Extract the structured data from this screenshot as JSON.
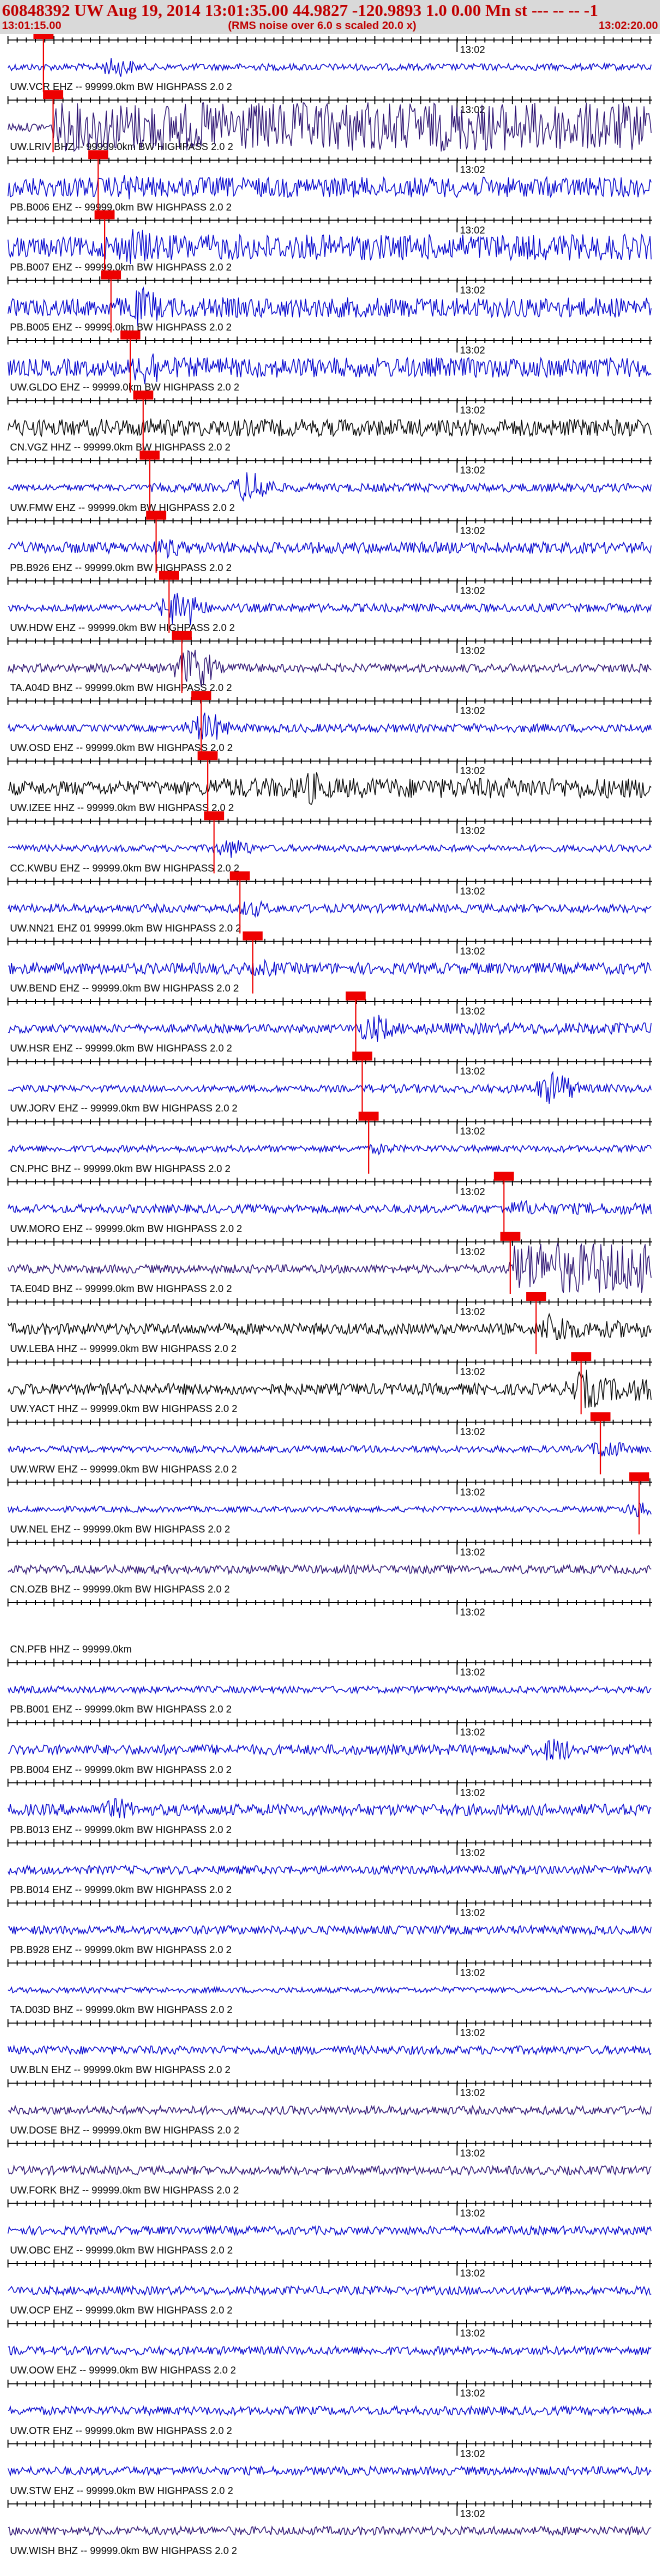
{
  "header": {
    "title": "60848392 UW Aug 19, 2014 13:01:35.00   44.9827 -120.9893  1.0 0.00 Mn st --- -- --  -1",
    "start_time": "13:01:15.00",
    "scale_note": "(RMS noise over 6.0 s scaled 20.0 x)",
    "end_time": "13:02:20.00"
  },
  "chart_data": {
    "type": "line",
    "title": "60848392 UW Aug 19, 2014 13:01:35.00   44.9827 -120.9893  1.0 0.00 Mn st --- -- --  -1",
    "x_range": [
      "13:01:15.00",
      "13:02:20.00"
    ],
    "minute_mark": "13:02",
    "colors": {
      "blue": "#0000cc",
      "purple": "#2a1070",
      "black": "#000000",
      "pick": "#ee0000"
    },
    "traces": [
      {
        "label": "UW.VCR EHZ -- 99999.0km BW HIGHPASS 2.0  2",
        "color": "blue",
        "pick_frac": 0.055,
        "burst_frac": 0.17,
        "burst_amp": 0.35,
        "noise": 0.12,
        "tail": 0.08
      },
      {
        "label": "UW.LRIV BHZ -- 99999.0km BW HIGHPASS 2.0  2",
        "color": "purple",
        "pick_frac": 0.07,
        "burst_frac": 0.55,
        "burst_amp": 1.0,
        "noise": 0.15,
        "tail": 0.85
      },
      {
        "label": "PB.B006 EHZ -- 99999.0km BW HIGHPASS 2.0  2",
        "color": "blue",
        "pick_frac": 0.14,
        "burst_frac": 0.19,
        "burst_amp": 0.5,
        "noise": 0.35,
        "tail": 0.3
      },
      {
        "label": "PB.B007 EHZ -- 99999.0km BW HIGHPASS 2.0  2",
        "color": "blue",
        "pick_frac": 0.15,
        "burst_frac": 0.2,
        "burst_amp": 0.7,
        "noise": 0.35,
        "tail": 0.45
      },
      {
        "label": "PB.B005 EHZ -- 99999.0km BW HIGHPASS 2.0  2",
        "color": "blue",
        "pick_frac": 0.16,
        "burst_frac": 0.21,
        "burst_amp": 0.7,
        "noise": 0.3,
        "tail": 0.35
      },
      {
        "label": "UW.GLDO EHZ -- 99999.0km BW HIGHPASS 2.0  2",
        "color": "blue",
        "pick_frac": 0.19,
        "burst_frac": 0.22,
        "burst_amp": 0.7,
        "noise": 0.3,
        "tail": 0.35
      },
      {
        "label": "CN.VGZ HHZ -- 99999.0km BW HIGHPASS 2.0  2",
        "color": "black",
        "pick_frac": 0.21,
        "burst_frac": 0.22,
        "burst_amp": 0.35,
        "noise": 0.3,
        "tail": 0.3
      },
      {
        "label": "UW.FMW EHZ -- 99999.0km BW HIGHPASS 2.0  2",
        "color": "blue",
        "pick_frac": 0.22,
        "burst_frac": 0.38,
        "burst_amp": 0.6,
        "noise": 0.12,
        "tail": 0.15
      },
      {
        "label": "PB.B926 EHZ -- 99999.0km BW HIGHPASS 2.0  2",
        "color": "blue",
        "pick_frac": 0.23,
        "burst_frac": 0.25,
        "burst_amp": 0.35,
        "noise": 0.2,
        "tail": 0.2
      },
      {
        "label": "UW.HDW EHZ -- 99999.0km BW HIGHPASS 2.0  2",
        "color": "blue",
        "pick_frac": 0.25,
        "burst_frac": 0.27,
        "burst_amp": 0.7,
        "noise": 0.12,
        "tail": 0.15
      },
      {
        "label": "TA.A04D BHZ -- 99999.0km BW HIGHPASS 2.0  2",
        "color": "purple",
        "pick_frac": 0.27,
        "burst_frac": 0.29,
        "burst_amp": 0.75,
        "noise": 0.15,
        "tail": 0.15
      },
      {
        "label": "UW.OSD EHZ -- 99999.0km BW HIGHPASS 2.0  2",
        "color": "blue",
        "pick_frac": 0.3,
        "burst_frac": 0.31,
        "burst_amp": 0.55,
        "noise": 0.12,
        "tail": 0.15
      },
      {
        "label": "UW.IZEE HHZ -- 99999.0km BW HIGHPASS 2.0  2",
        "color": "black",
        "pick_frac": 0.31,
        "burst_frac": 0.47,
        "burst_amp": 0.6,
        "noise": 0.25,
        "tail": 0.35
      },
      {
        "label": "CC.KWBU EHZ -- 99999.0km BW HIGHPASS 2.0  2",
        "color": "blue",
        "pick_frac": 0.32,
        "burst_frac": 0.35,
        "burst_amp": 0.35,
        "noise": 0.12,
        "tail": 0.12
      },
      {
        "label": "UW.NN21 EHZ 01 99999.0km BW HIGHPASS 2.0  2",
        "color": "blue",
        "pick_frac": 0.36,
        "burst_frac": 0.38,
        "burst_amp": 0.3,
        "noise": 0.15,
        "tail": 0.15
      },
      {
        "label": "UW.BEND EHZ -- 99999.0km BW HIGHPASS 2.0  2",
        "color": "blue",
        "pick_frac": 0.38,
        "burst_frac": 0.4,
        "burst_amp": 0.3,
        "noise": 0.2,
        "tail": 0.2
      },
      {
        "label": "UW.HSR EHZ -- 99999.0km BW HIGHPASS 2.0  2",
        "color": "blue",
        "pick_frac": 0.54,
        "burst_frac": 0.57,
        "burst_amp": 0.5,
        "noise": 0.15,
        "tail": 0.2
      },
      {
        "label": "UW.JORV EHZ -- 99999.0km BW HIGHPASS 2.0  2",
        "color": "blue",
        "pick_frac": 0.55,
        "burst_frac": 0.85,
        "burst_amp": 0.6,
        "noise": 0.12,
        "tail": 0.15
      },
      {
        "label": "CN.PHC BHZ -- 99999.0km BW HIGHPASS 2.0  2",
        "color": "blue",
        "pick_frac": 0.56,
        "burst_frac": 0.58,
        "burst_amp": 0.2,
        "noise": 0.12,
        "tail": 0.12
      },
      {
        "label": "UW.MORO EHZ -- 99999.0km BW HIGHPASS 2.0  2",
        "color": "blue",
        "pick_frac": 0.77,
        "burst_frac": 0.8,
        "burst_amp": 0.3,
        "noise": 0.15,
        "tail": 0.2
      },
      {
        "label": "TA.E04D BHZ -- 99999.0km BW HIGHPASS 2.0  2",
        "color": "purple",
        "pick_frac": 0.78,
        "burst_frac": 0.82,
        "burst_amp": 1.0,
        "noise": 0.15,
        "tail": 0.9
      },
      {
        "label": "UW.LEBA HHZ -- 99999.0km BW HIGHPASS 2.0  2",
        "color": "black",
        "pick_frac": 0.82,
        "burst_frac": 0.85,
        "burst_amp": 0.6,
        "noise": 0.2,
        "tail": 0.3
      },
      {
        "label": "UW.YACT HHZ -- 99999.0km BW HIGHPASS 2.0  2",
        "color": "black",
        "pick_frac": 0.89,
        "burst_frac": 0.9,
        "burst_amp": 0.7,
        "noise": 0.2,
        "tail": 0.4
      },
      {
        "label": "UW.WRW EHZ -- 99999.0km BW HIGHPASS 2.0  2",
        "color": "blue",
        "pick_frac": 0.92,
        "burst_frac": 0.93,
        "burst_amp": 0.35,
        "noise": 0.12,
        "tail": 0.15
      },
      {
        "label": "UW.NEL EHZ -- 99999.0km BW HIGHPASS 2.0  2",
        "color": "blue",
        "pick_frac": 0.98,
        "burst_frac": 0.985,
        "burst_amp": 0.3,
        "noise": 0.1,
        "tail": 0.1
      },
      {
        "label": "CN.OZB BHZ -- 99999.0km BW HIGHPASS 2.0  2",
        "color": "purple",
        "pick_frac": null,
        "burst_frac": null,
        "burst_amp": 0,
        "noise": 0.15,
        "tail": 0.15
      },
      {
        "label": "CN.PFB HHZ -- 99999.0km",
        "color": "blue",
        "pick_frac": null,
        "burst_frac": null,
        "burst_amp": 0,
        "noise": 0,
        "tail": 0
      },
      {
        "label": "PB.B001 EHZ -- 99999.0km BW HIGHPASS 2.0  2",
        "color": "blue",
        "pick_frac": null,
        "burst_frac": null,
        "burst_amp": 0,
        "noise": 0.12,
        "tail": 0.12
      },
      {
        "label": "PB.B004 EHZ -- 99999.0km BW HIGHPASS 2.0  2",
        "color": "blue",
        "pick_frac": null,
        "burst_frac": 0.85,
        "burst_amp": 0.45,
        "noise": 0.18,
        "tail": 0.2
      },
      {
        "label": "PB.B013 EHZ -- 99999.0km BW HIGHPASS 2.0  2",
        "color": "blue",
        "pick_frac": null,
        "burst_frac": 0.17,
        "burst_amp": 0.4,
        "noise": 0.2,
        "tail": 0.25
      },
      {
        "label": "PB.B014 EHZ -- 99999.0km BW HIGHPASS 2.0  2",
        "color": "blue",
        "pick_frac": null,
        "burst_frac": null,
        "burst_amp": 0,
        "noise": 0.15,
        "tail": 0.15
      },
      {
        "label": "PB.B928 EHZ -- 99999.0km BW HIGHPASS 2.0  2",
        "color": "blue",
        "pick_frac": null,
        "burst_frac": null,
        "burst_amp": 0,
        "noise": 0.15,
        "tail": 0.15
      },
      {
        "label": "TA.D03D BHZ -- 99999.0km BW HIGHPASS 2.0  2",
        "color": "blue",
        "pick_frac": null,
        "burst_frac": null,
        "burst_amp": 0,
        "noise": 0.1,
        "tail": 0.1
      },
      {
        "label": "UW.BLN EHZ -- 99999.0km BW HIGHPASS 2.0  2",
        "color": "blue",
        "pick_frac": null,
        "burst_frac": null,
        "burst_amp": 0,
        "noise": 0.15,
        "tail": 0.15
      },
      {
        "label": "UW.DOSE BHZ -- 99999.0km BW HIGHPASS 2.0  2",
        "color": "purple",
        "pick_frac": null,
        "burst_frac": null,
        "burst_amp": 0,
        "noise": 0.15,
        "tail": 0.15
      },
      {
        "label": "UW.FORK BHZ -- 99999.0km BW HIGHPASS 2.0  2",
        "color": "purple",
        "pick_frac": null,
        "burst_frac": null,
        "burst_amp": 0,
        "noise": 0.15,
        "tail": 0.15
      },
      {
        "label": "UW.OBC EHZ -- 99999.0km BW HIGHPASS 2.0  2",
        "color": "blue",
        "pick_frac": null,
        "burst_frac": null,
        "burst_amp": 0,
        "noise": 0.15,
        "tail": 0.15
      },
      {
        "label": "UW.OCP EHZ -- 99999.0km BW HIGHPASS 2.0  2",
        "color": "blue",
        "pick_frac": null,
        "burst_frac": null,
        "burst_amp": 0,
        "noise": 0.15,
        "tail": 0.15
      },
      {
        "label": "UW.OOW EHZ -- 99999.0km BW HIGHPASS 2.0  2",
        "color": "blue",
        "pick_frac": null,
        "burst_frac": null,
        "burst_amp": 0,
        "noise": 0.15,
        "tail": 0.15
      },
      {
        "label": "UW.OTR EHZ -- 99999.0km BW HIGHPASS 2.0  2",
        "color": "blue",
        "pick_frac": null,
        "burst_frac": null,
        "burst_amp": 0,
        "noise": 0.15,
        "tail": 0.15
      },
      {
        "label": "UW.STW EHZ -- 99999.0km BW HIGHPASS 2.0  2",
        "color": "blue",
        "pick_frac": null,
        "burst_frac": null,
        "burst_amp": 0,
        "noise": 0.15,
        "tail": 0.15
      },
      {
        "label": "UW.WISH BHZ -- 99999.0km BW HIGHPASS 2.0  2",
        "color": "purple",
        "pick_frac": null,
        "burst_frac": null,
        "burst_amp": 0,
        "noise": 0.15,
        "tail": 0.15
      }
    ]
  }
}
